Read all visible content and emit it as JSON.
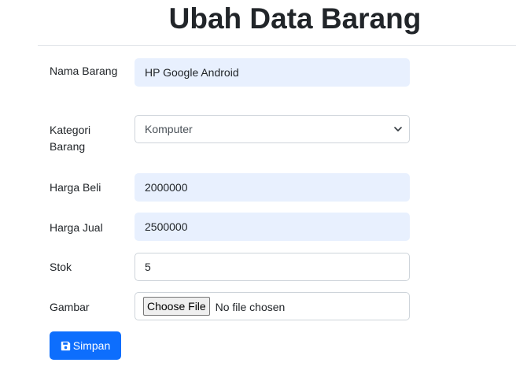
{
  "page": {
    "title": "Ubah Data Barang"
  },
  "form": {
    "nama": {
      "label": "Nama Barang",
      "value": "HP Google Android"
    },
    "kategori": {
      "label": "Kategori Barang",
      "selected": "Komputer",
      "icon": "chevron-down-icon"
    },
    "harga_beli": {
      "label": "Harga Beli",
      "value": "2000000"
    },
    "harga_jual": {
      "label": "Harga Jual",
      "value": "2500000"
    },
    "stok": {
      "label": "Stok",
      "value": "5"
    },
    "gambar": {
      "label": "Gambar",
      "button_label": "Choose File",
      "status": "No file chosen"
    },
    "submit": {
      "label": "Simpan",
      "icon": "save-icon"
    }
  },
  "colors": {
    "primary": "#0d6efd",
    "autofill": "#e8f0fe",
    "border": "#ced4da",
    "text": "#212529"
  }
}
